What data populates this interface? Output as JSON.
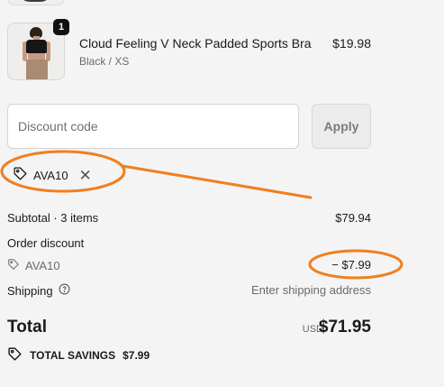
{
  "cart": {
    "items": [
      {
        "name": "Cloud Feeling V Neck Padded Sports Bra",
        "variant": "Black / XS",
        "price": "$19.98",
        "quantity": "1"
      }
    ]
  },
  "discount": {
    "placeholder": "Discount code",
    "apply_label": "Apply",
    "applied_code": "AVA10"
  },
  "summary": {
    "subtotal_label": "Subtotal · 3 items",
    "subtotal_value": "$79.94",
    "order_discount_label": "Order discount",
    "discount_code": "AVA10",
    "discount_value": "− $7.99",
    "shipping_label": "Shipping",
    "shipping_value": "Enter shipping address",
    "total_label": "Total",
    "currency": "USD",
    "total_value": "$71.95",
    "savings_label": "TOTAL SAVINGS",
    "savings_value": "$7.99"
  },
  "colors": {
    "annotation": "#f07f1f",
    "background": "#f4f4f4"
  },
  "icons": [
    "tag-icon",
    "close-icon",
    "help-circle-icon"
  ]
}
